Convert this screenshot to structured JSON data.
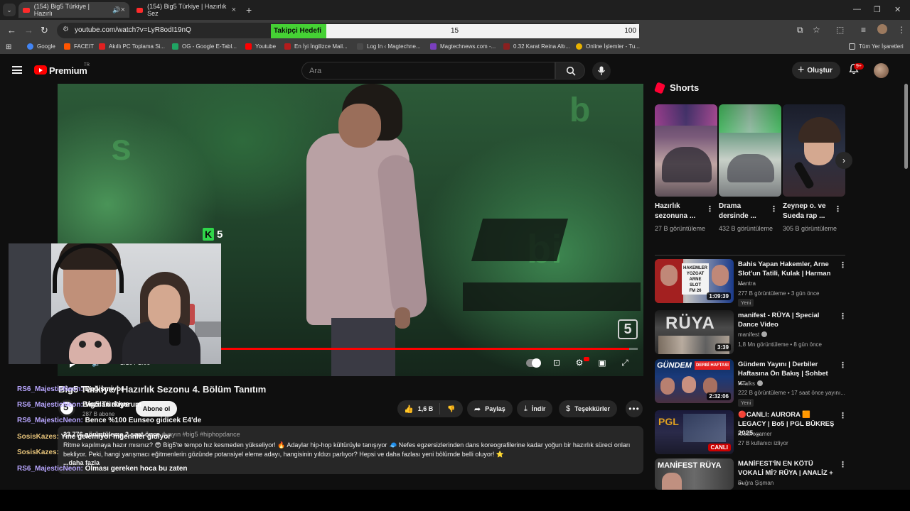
{
  "browser": {
    "tabs": [
      {
        "label": "(154) Big5 Türkiye | Hazırlı",
        "active": true
      },
      {
        "label": "(154) Big5 Türkiye | Hazırlık Sez",
        "active": false
      }
    ],
    "url": "youtube.com/watch?v=LyR8odI19nQ",
    "bookmarks": [
      "Google",
      "FACEIT",
      "Akıllı PC Toplama Si...",
      "OG - Google E-Tabl...",
      "Youtube",
      "En İyi İngilizce Mail...",
      "Log In ‹ Magtechne...",
      "Magtechnews.com -...",
      "0.32 Karat Reina Altı...",
      "Online İşlemler - Tu...",
      "Tüm Yer İşaretleri"
    ]
  },
  "follower_goal": {
    "label": "Takipçi Hedefi",
    "current": "15",
    "target": "100",
    "progress": 0.15
  },
  "header": {
    "brand": "Premium",
    "region": "TR",
    "search_placeholder": "Ara",
    "create_label": "Oluştur",
    "notification_count": "9+"
  },
  "player": {
    "overlay_logo_letter": "K",
    "overlay_logo_number": "5",
    "channel_watermark": "5",
    "time": "1:10 / 1:09",
    "progress": 0.98
  },
  "video": {
    "title": "Big5 Türkiye | Hazırlık Sezonu 4. Bölüm Tanıtım",
    "channel": "Big5 Türkiye",
    "subscribers": "287 B abone",
    "subscribe_label": "Abone ol",
    "likes": "1,6 B",
    "share_label": "Paylaş",
    "download_label": "İndir",
    "thanks_label": "Teşekkürler",
    "description": {
      "meta": "23.776 görüntüleme  2 saat önce ",
      "tags": "#yayın #big5 #hiphopdance",
      "body": "Ritme kapılmaya hazır mısınız? 😎 Big5'te tempo hız kesmeden yükseliyor! 🔥 Adaylar hip-hop kültürüyle tanışıyor 🧢 Nefes egzersizlerinden dans koreografilerine kadar yoğun bir hazırlık süreci onları bekliyor. Peki, hangi yarışmacı eğitmenlerin gözünde potansiyel eleme adayı, hangisinin yıldızı parlıyor? Hepsi ve daha fazlası yeni bölümde belli oluyor! ⭐",
      "more": "...daha fazla"
    }
  },
  "chat": [
    {
      "user": "RS6_MajesticNeon:",
      "msg": "Değişmiyor",
      "color": "u1"
    },
    {
      "user": "RS6_MajesticNeon:",
      "msg": "Vozdan alıyorum",
      "color": "u1"
    },
    {
      "user": "RS6_MajesticNeon:",
      "msg": "Bence %100 Eunseo gidicek E4'de",
      "color": "u1"
    },
    {
      "user": "SosisKazes:",
      "msg": "Yine gelemiyor mgennler gidiyor",
      "color": "u2"
    },
    {
      "user": "SosisKazes:",
      "msg": "",
      "color": "u2"
    },
    {
      "user": "RS6_MajesticNeon:",
      "msg": "Olması gereken hoca bu zaten",
      "color": "u1"
    }
  ],
  "shorts": {
    "title": "Shorts",
    "items": [
      {
        "title": "Hazırlık sezonuna ...",
        "views": "27 B görüntüleme"
      },
      {
        "title": "Drama dersinde ...",
        "views": "432 B görüntüleme"
      },
      {
        "title": "Zeynep o. ve Sueda rap ...",
        "views": "305 B görüntüleme"
      }
    ]
  },
  "recommendations": [
    {
      "title": "Bahis Yapan Hakemler, Arne Slot'un Tatili, Kulak | Harman ...",
      "channel": "Mantra",
      "meta": "277 B görüntüleme • 3 gün önce",
      "badge": "Yeni",
      "duration": "1:09:39",
      "verified": false,
      "live": false
    },
    {
      "title": "manifest - RÜYA | Special Dance Video",
      "channel": "manifest",
      "meta": "1,8 Mn görüntüleme • 8 gün önce",
      "badge": "",
      "duration": "3:39",
      "verified": true,
      "live": false
    },
    {
      "title": "Gündem Yayını | Derbiler Haftasına Ön Bakış | Sohbet v...",
      "channel": "HTalks",
      "meta": "222 B görüntüleme • 17 saat önce yayını...",
      "badge": "Yeni",
      "duration": "2:32:06",
      "verified": true,
      "live": false
    },
    {
      "title": "🔴CANLI: AURORA 🟧 LEGACY | Bo5 | PGL BÜKREŞ 2025 ...",
      "channel": "rootthegamer",
      "meta": "27 B kullanıcı izliyor",
      "badge": "",
      "duration": "CANLI",
      "verified": false,
      "live": true
    },
    {
      "title": "MANİFEST'İN EN KÖTÜ VOKALİ Mİ? RÜYA | ANALİZ + ...",
      "channel": "Buğra Şişman",
      "meta": "",
      "badge": "",
      "duration": "",
      "verified": false,
      "live": false
    }
  ],
  "colors": {
    "accent": "#ff0000",
    "goal_fill": "#45d134",
    "chat_user_a": "#b8a6ff",
    "chat_user_b": "#e6c37a"
  }
}
